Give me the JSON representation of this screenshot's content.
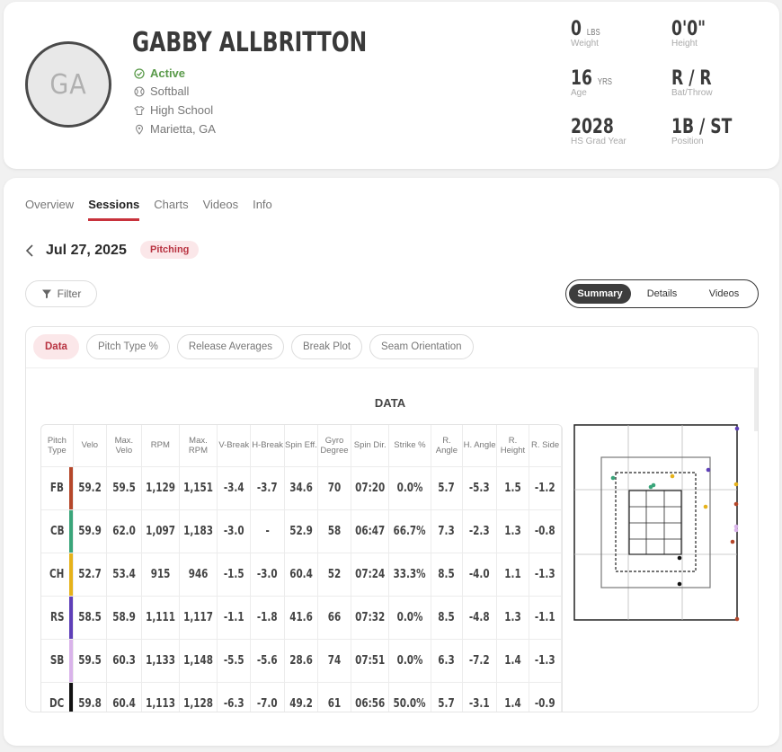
{
  "profile": {
    "initials": "GA",
    "name": "GABBY ALLBRITTON",
    "status": "Active",
    "sport": "Softball",
    "level": "High School",
    "location": "Marietta, GA",
    "stats": [
      {
        "value": "0",
        "unit": "LBS",
        "label": "Weight"
      },
      {
        "value": "0'0\"",
        "unit": "",
        "label": "Height"
      },
      {
        "value": "16",
        "unit": "YRS",
        "label": "Age"
      },
      {
        "value": "R / R",
        "unit": "",
        "label": "Bat/Throw"
      },
      {
        "value": "2028",
        "unit": "",
        "label": "HS Grad Year"
      },
      {
        "value": "1B / ST",
        "unit": "",
        "label": "Position"
      }
    ]
  },
  "tabs": [
    "Overview",
    "Sessions",
    "Charts",
    "Videos",
    "Info"
  ],
  "active_tab": "Sessions",
  "session": {
    "date": "Jul 27, 2025",
    "type": "Pitching"
  },
  "filter_label": "Filter",
  "view_toggle": [
    "Summary",
    "Details",
    "Videos"
  ],
  "active_view": "Summary",
  "sub_tabs": [
    "Data",
    "Pitch Type %",
    "Release Averages",
    "Break Plot",
    "Seam Orientation"
  ],
  "section_title": "DATA",
  "table": {
    "headers": [
      "Pitch Type",
      "Velo",
      "Max. Velo",
      "RPM",
      "Max. RPM",
      "V-Break",
      "H-Break",
      "Spin Eff.",
      "Gyro Degree",
      "Spin Dir.",
      "Strike %",
      "R. Angle",
      "H. Angle",
      "R. Height",
      "R. Side"
    ],
    "rows": [
      {
        "type": "FB",
        "color": "#b5472a",
        "cells": [
          "59.2",
          "59.5",
          "1,129",
          "1,151",
          "-3.4",
          "-3.7",
          "34.6",
          "70",
          "07:20",
          "0.0%",
          "5.7",
          "-5.3",
          "1.5",
          "-1.2"
        ]
      },
      {
        "type": "CB",
        "color": "#3aa57a",
        "cells": [
          "59.9",
          "62.0",
          "1,097",
          "1,183",
          "-3.0",
          "-",
          "52.9",
          "58",
          "06:47",
          "66.7%",
          "7.3",
          "-2.3",
          "1.3",
          "-0.8"
        ]
      },
      {
        "type": "CH",
        "color": "#e6b21a",
        "cells": [
          "52.7",
          "53.4",
          "915",
          "946",
          "-1.5",
          "-3.0",
          "60.4",
          "52",
          "07:24",
          "33.3%",
          "8.5",
          "-4.0",
          "1.1",
          "-1.3"
        ]
      },
      {
        "type": "RS",
        "color": "#5e3fb8",
        "cells": [
          "58.5",
          "58.9",
          "1,111",
          "1,117",
          "-1.1",
          "-1.8",
          "41.6",
          "66",
          "07:32",
          "0.0%",
          "8.5",
          "-4.8",
          "1.3",
          "-1.1"
        ]
      },
      {
        "type": "SB",
        "color": "#d9b3ea",
        "cells": [
          "59.5",
          "60.3",
          "1,133",
          "1,148",
          "-5.5",
          "-5.6",
          "28.6",
          "74",
          "07:51",
          "0.0%",
          "6.3",
          "-7.2",
          "1.4",
          "-1.3"
        ]
      },
      {
        "type": "DC",
        "color": "#111111",
        "cells": [
          "59.8",
          "60.4",
          "1,113",
          "1,128",
          "-6.3",
          "-7.0",
          "49.2",
          "61",
          "06:56",
          "50.0%",
          "5.7",
          "-3.1",
          "1.4",
          "-0.9"
        ]
      }
    ]
  }
}
